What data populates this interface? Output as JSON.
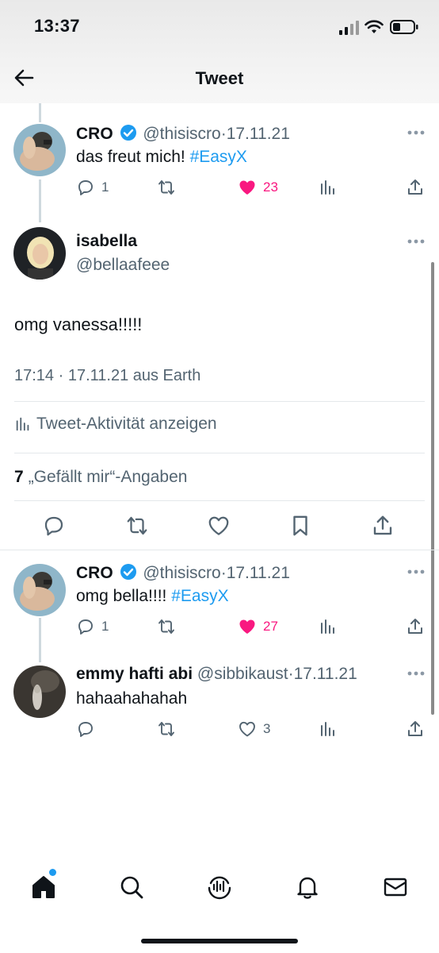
{
  "status_bar": {
    "time": "13:37"
  },
  "header": {
    "title": "Tweet"
  },
  "tweets_above": [
    {
      "name": "CRO",
      "verified": true,
      "handle": "@thisiscro",
      "date": "17.11.21",
      "text_plain": "das freut mich! ",
      "hashtag": "#EasyX",
      "replies": "1",
      "likes": "23",
      "liked": true
    }
  ],
  "main_tweet": {
    "name": "isabella",
    "handle": "@bellaafeee",
    "text": "omg vanessa!!!!!",
    "meta": "17:14 · 17.11.21 aus Earth",
    "activity_label": "Tweet-Aktivität anzeigen",
    "likes_count": "7",
    "likes_label": "„Gefällt mir“-Angaben"
  },
  "replies": [
    {
      "name": "CRO",
      "verified": true,
      "handle": "@thisiscro",
      "date": "17.11.21",
      "text_plain": "omg bella!!!! ",
      "hashtag": "#EasyX",
      "replies": "1",
      "likes": "27",
      "liked": true
    },
    {
      "name": "emmy hafti abi",
      "verified": false,
      "handle": "@sibbikaust",
      "date": "17.11.21",
      "text_plain": "hahaahahahah",
      "replies": "",
      "likes": "3",
      "liked": false
    }
  ],
  "separator": "·",
  "colors": {
    "accent": "#1d9bf0",
    "like": "#f91880",
    "secondary_text": "#536471"
  },
  "icons": [
    "back-arrow-icon",
    "verified-icon",
    "more-icon",
    "reply-icon",
    "retweet-icon",
    "heart-icon",
    "views-icon",
    "share-icon",
    "bookmark-icon",
    "home-icon",
    "search-icon",
    "spaces-icon",
    "bell-icon",
    "mail-icon"
  ]
}
